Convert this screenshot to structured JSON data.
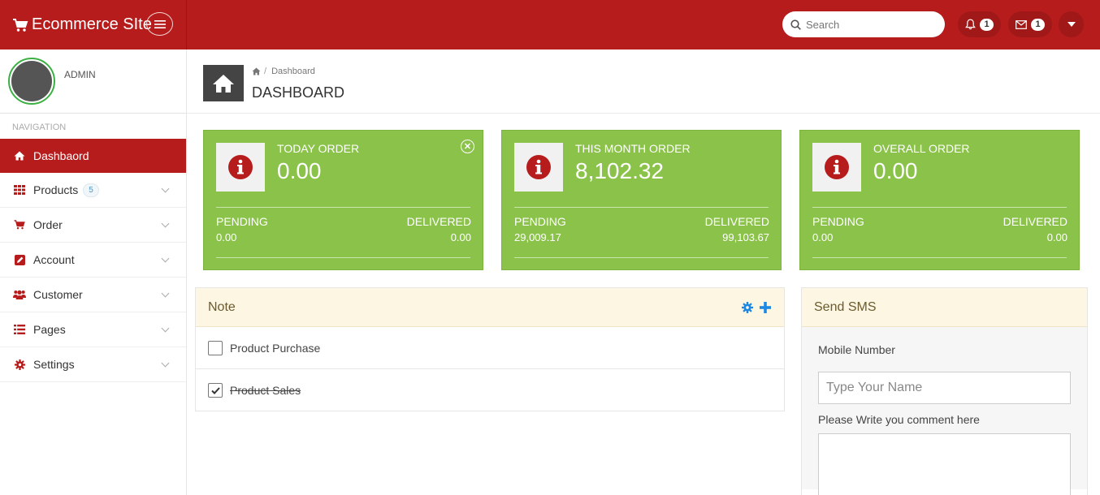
{
  "app": {
    "brand": "Ecommerce SIte",
    "colors": {
      "primary": "#b71c1c",
      "stat_card": "#8bc34a",
      "panel_header": "#fcf6e3"
    }
  },
  "topbar": {
    "search_placeholder": "Search",
    "notifications_count": "1",
    "messages_count": "1"
  },
  "sidebar": {
    "user_name": "ADMIN",
    "heading": "NAVIGATION",
    "items": [
      {
        "label": "Dashbaord",
        "icon": "home-icon",
        "active": true
      },
      {
        "label": "Products",
        "icon": "grid-icon",
        "badge": "5"
      },
      {
        "label": "Order",
        "icon": "cart-icon"
      },
      {
        "label": "Account",
        "icon": "edit-icon"
      },
      {
        "label": "Customer",
        "icon": "users-icon"
      },
      {
        "label": "Pages",
        "icon": "list-icon"
      },
      {
        "label": "Settings",
        "icon": "gear-icon"
      }
    ]
  },
  "header": {
    "breadcrumb_current": "Dashboard",
    "title": "DASHBOARD"
  },
  "stats": [
    {
      "label": "TODAY ORDER",
      "value": "0.00",
      "pending_label": "PENDING",
      "pending": "0.00",
      "delivered_label": "DELIVERED",
      "delivered": "0.00"
    },
    {
      "label": "THIS MONTH ORDER",
      "value": "8,102.32",
      "pending_label": "PENDING",
      "pending": "29,009.17",
      "delivered_label": "DELIVERED",
      "delivered": "99,103.67"
    },
    {
      "label": "OVERALL ORDER",
      "value": "0.00",
      "pending_label": "PENDING",
      "pending": "0.00",
      "delivered_label": "DELIVERED",
      "delivered": "0.00"
    }
  ],
  "note": {
    "title": "Note",
    "items": [
      {
        "label": "Product Purchase",
        "checked": false
      },
      {
        "label": "Product Sales",
        "checked": true
      }
    ]
  },
  "sms": {
    "title": "Send SMS",
    "mobile_label": "Mobile Number",
    "mobile_placeholder": "Type Your Name",
    "comment_label": "Please Write you comment here"
  }
}
